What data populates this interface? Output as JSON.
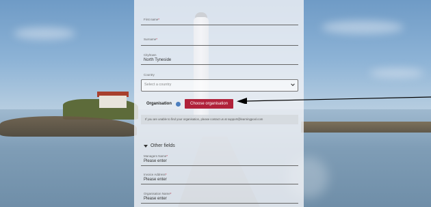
{
  "form": {
    "first_name": {
      "label": "First name",
      "required": "*",
      "value": ""
    },
    "surname": {
      "label": "Surname",
      "required": "*",
      "value": ""
    },
    "city": {
      "label": "City/town",
      "value": "North Tyneside"
    },
    "country": {
      "label": "Country",
      "placeholder": "Select a country"
    },
    "organisation": {
      "label": "Organisation",
      "button_label": "Choose organisation"
    },
    "notice": "If you are unable to find your organisation, please contact us at support@learningpool.com",
    "other_fields": {
      "title": "Other fields",
      "managers_name": {
        "label": "Managers Name",
        "required": "*",
        "value": "Please enter"
      },
      "invoice_address": {
        "label": "Invoice Address",
        "required": "*",
        "value": "Please enter"
      },
      "organisation_name": {
        "label": "Organisation Name",
        "required": "*",
        "value": "Please enter"
      }
    }
  },
  "colors": {
    "accent": "#b0213a",
    "info": "#4d7fbf"
  },
  "icons": [
    "info-icon",
    "chevron-down-icon",
    "arrow-left-icon",
    "expand-triangle-icon"
  ]
}
